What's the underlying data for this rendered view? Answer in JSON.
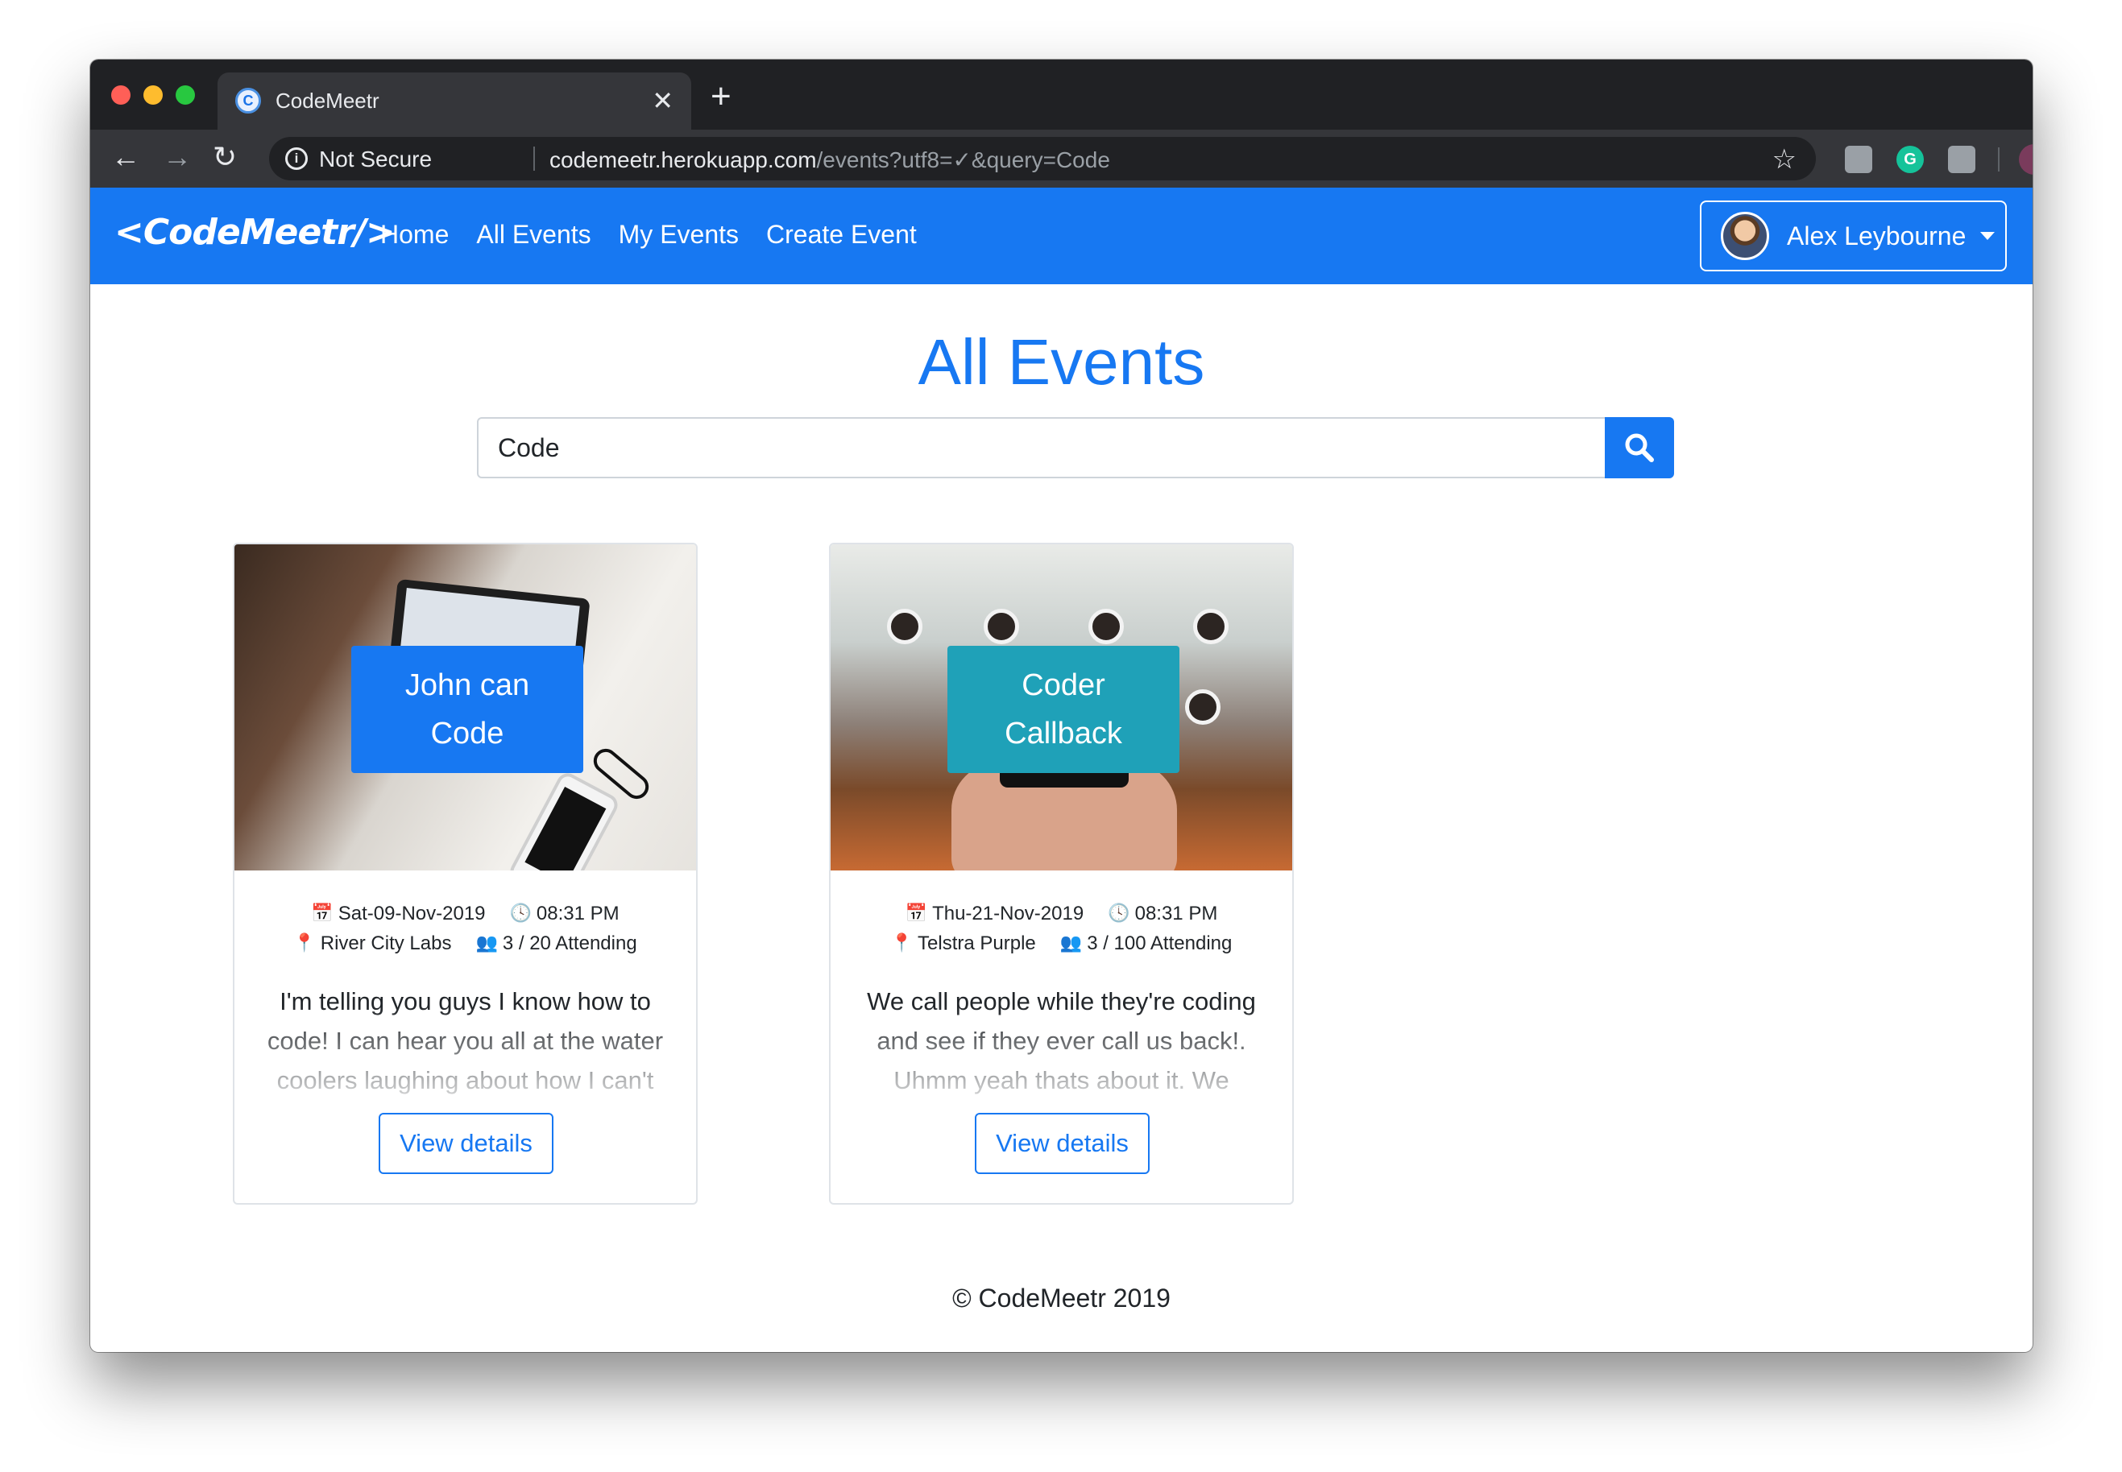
{
  "browser": {
    "tab_title": "CodeMeetr",
    "tab_favicon_letter": "C",
    "close_glyph": "✕",
    "new_tab_glyph": "+",
    "security_label": "Not Secure",
    "url_host": "codemeetr.herokuapp.com",
    "url_path": "/events?utf8=✓&query=Code",
    "back_glyph": "←",
    "forward_glyph": "→",
    "reload_glyph": "↻",
    "star_glyph": "☆",
    "menu_glyph": "⋮",
    "grammarly_letter": "G"
  },
  "navbar": {
    "brand": "<CodeMeetr/>",
    "links": [
      "Home",
      "All Events",
      "My Events",
      "Create Event"
    ],
    "user_name": "Alex Leybourne",
    "bg_color": "#1778f2"
  },
  "main": {
    "title": "All Events",
    "search": {
      "value": "Code",
      "button_icon": "search-icon"
    }
  },
  "events": [
    {
      "title_line1": "John can",
      "title_line2": "Code",
      "badge_color": "#1778f2",
      "date": "Sat-09-Nov-2019",
      "time": "08:31 PM",
      "location": "River City Labs",
      "attending": "3 / 20 Attending",
      "description": "I'm telling you guys I know how to code! I can hear you all at the water coolers laughing about how I can't",
      "button_label": "View details"
    },
    {
      "title_line1": "Coder",
      "title_line2": "Callback",
      "badge_color": "#1fa1b8",
      "date": "Thu-21-Nov-2019",
      "time": "08:31 PM",
      "location": "Telstra Purple",
      "attending": "3 / 100 Attending",
      "description": "We call people while they're coding and see if they ever call us back!. Uhmm yeah thats about it. We",
      "button_label": "View details"
    }
  ],
  "footer": {
    "text": "© CodeMeetr 2019"
  }
}
